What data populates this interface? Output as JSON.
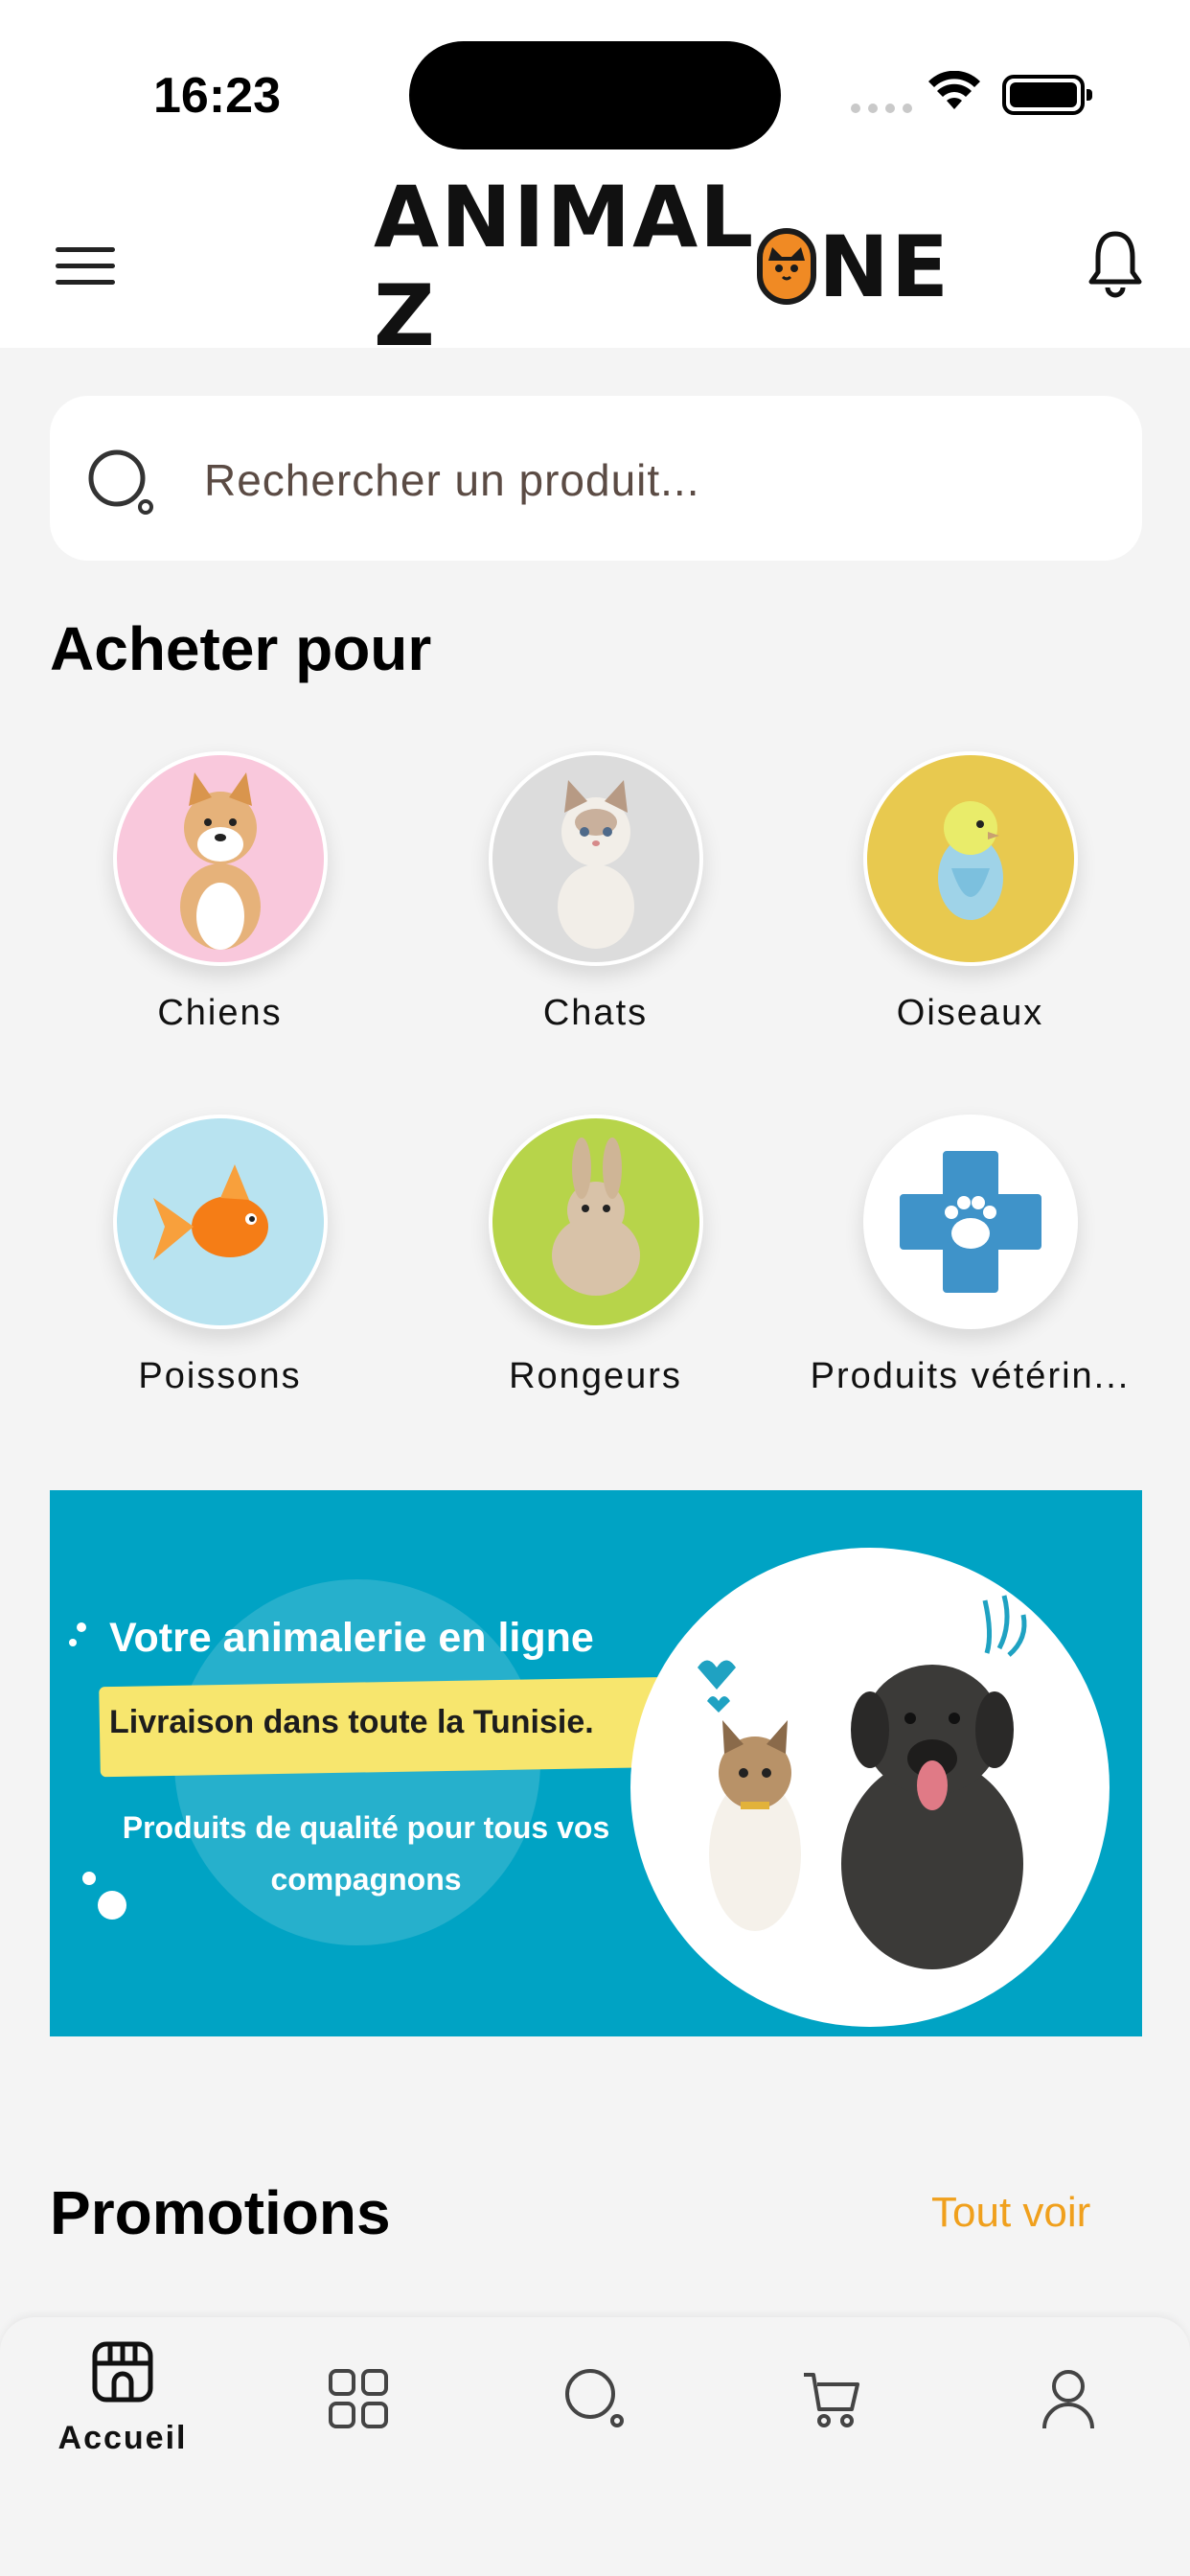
{
  "status_bar": {
    "time": "16:23"
  },
  "header": {
    "brand_left": "ANIMAL Z",
    "brand_right": "NE"
  },
  "search": {
    "placeholder": "Rechercher un produit..."
  },
  "shop_for": {
    "title": "Acheter pour",
    "categories": [
      {
        "label": "Chiens",
        "color": "#f9c8dc",
        "icon": "dog-icon"
      },
      {
        "label": "Chats",
        "color": "#dcdcdc",
        "icon": "cat-icon"
      },
      {
        "label": "Oiseaux",
        "color": "#e8c94f",
        "icon": "bird-icon"
      },
      {
        "label": "Poissons",
        "color": "#b8e3f0",
        "icon": "fish-icon"
      },
      {
        "label": "Rongeurs",
        "color": "#b7d44a",
        "icon": "rabbit-icon"
      },
      {
        "label": "Produits vétérin...",
        "color": "#ffffff",
        "icon": "vet-cross-icon"
      }
    ]
  },
  "banner": {
    "headline": "Votre animalerie en ligne",
    "tag": "Livraison dans toute la Tunisie.",
    "subline": "Produits de qualité pour tous vos compagnons"
  },
  "promotions": {
    "title": "Promotions",
    "see_all": "Tout voir"
  },
  "tabbar": {
    "home_label": "Accueil",
    "icons": [
      "store-icon",
      "categories-icon",
      "search-icon",
      "cart-icon",
      "profile-icon"
    ]
  },
  "colors": {
    "accent": "#f0a01d",
    "banner_bg": "#00a3c4",
    "background": "#f4f4f4"
  }
}
